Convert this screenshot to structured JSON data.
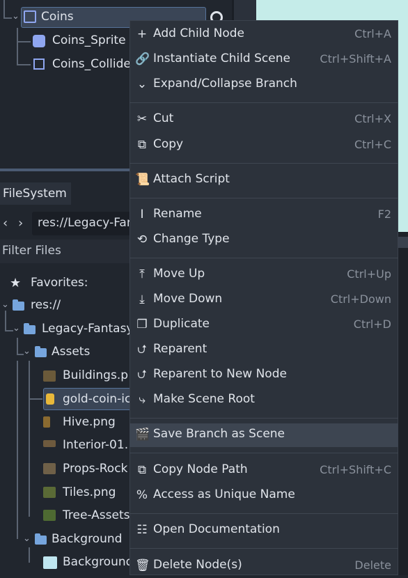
{
  "scene_tree": {
    "root": {
      "label": "Coins"
    },
    "children": [
      {
        "label": "Coins_Sprite",
        "icon": "sprite-icon"
      },
      {
        "label": "Coins_Collide",
        "icon": "collision-shape-icon"
      }
    ]
  },
  "filesystem": {
    "tab_label": "FileSystem",
    "path": "res://Legacy-Far",
    "filter_placeholder": "Filter Files",
    "favorites_label": "Favorites:",
    "tree": [
      {
        "label": "res://",
        "type": "folder"
      },
      {
        "label": "Legacy-Fantasy",
        "type": "folder"
      },
      {
        "label": "Assets",
        "type": "folder"
      },
      {
        "label": "Buildings.p",
        "type": "image"
      },
      {
        "label": "gold-coin-ic",
        "type": "image",
        "selected": true
      },
      {
        "label": "Hive.png",
        "type": "image"
      },
      {
        "label": "Interior-01.",
        "type": "image"
      },
      {
        "label": "Props-Rock",
        "type": "image"
      },
      {
        "label": "Tiles.png",
        "type": "image"
      },
      {
        "label": "Tree-Assets",
        "type": "image"
      },
      {
        "label": "Background",
        "type": "folder"
      },
      {
        "label": "Background",
        "type": "image"
      }
    ]
  },
  "context_menu": {
    "items": [
      {
        "label": "Add Child Node",
        "shortcut": "Ctrl+A",
        "icon": "plus-icon"
      },
      {
        "label": "Instantiate Child Scene",
        "shortcut": "Ctrl+Shift+A",
        "icon": "link-icon"
      },
      {
        "label": "Expand/Collapse Branch",
        "shortcut": "",
        "icon": "chevron-down-icon"
      },
      {
        "label": "Cut",
        "shortcut": "Ctrl+X",
        "icon": "scissors-icon"
      },
      {
        "label": "Copy",
        "shortcut": "Ctrl+C",
        "icon": "copy-icon"
      },
      {
        "label": "Attach Script",
        "shortcut": "",
        "icon": "script-icon"
      },
      {
        "label": "Rename",
        "shortcut": "F2",
        "icon": "rename-icon"
      },
      {
        "label": "Change Type",
        "shortcut": "",
        "icon": "rotate-icon"
      },
      {
        "label": "Move Up",
        "shortcut": "Ctrl+Up",
        "icon": "arrow-up-icon"
      },
      {
        "label": "Move Down",
        "shortcut": "Ctrl+Down",
        "icon": "arrow-down-icon"
      },
      {
        "label": "Duplicate",
        "shortcut": "Ctrl+D",
        "icon": "duplicate-icon"
      },
      {
        "label": "Reparent",
        "shortcut": "",
        "icon": "reparent-icon"
      },
      {
        "label": "Reparent to New Node",
        "shortcut": "",
        "icon": "reparent-new-icon"
      },
      {
        "label": "Make Scene Root",
        "shortcut": "",
        "icon": "scene-root-icon"
      },
      {
        "label": "Save Branch as Scene",
        "shortcut": "",
        "icon": "save-branch-icon",
        "highlighted": true
      },
      {
        "label": "Copy Node Path",
        "shortcut": "Ctrl+Shift+C",
        "icon": "node-path-icon"
      },
      {
        "label": "Access as Unique Name",
        "shortcut": "",
        "icon": "percent-icon"
      },
      {
        "label": "Open Documentation",
        "shortcut": "",
        "icon": "documentation-icon"
      },
      {
        "label": "Delete Node(s)",
        "shortcut": "Delete",
        "icon": "trash-icon"
      }
    ]
  },
  "colors": {
    "background": "#21262e",
    "menu": "#2c323b",
    "highlight": "#3d4551",
    "accent": "#56739a",
    "folder": "#76a5dd"
  }
}
